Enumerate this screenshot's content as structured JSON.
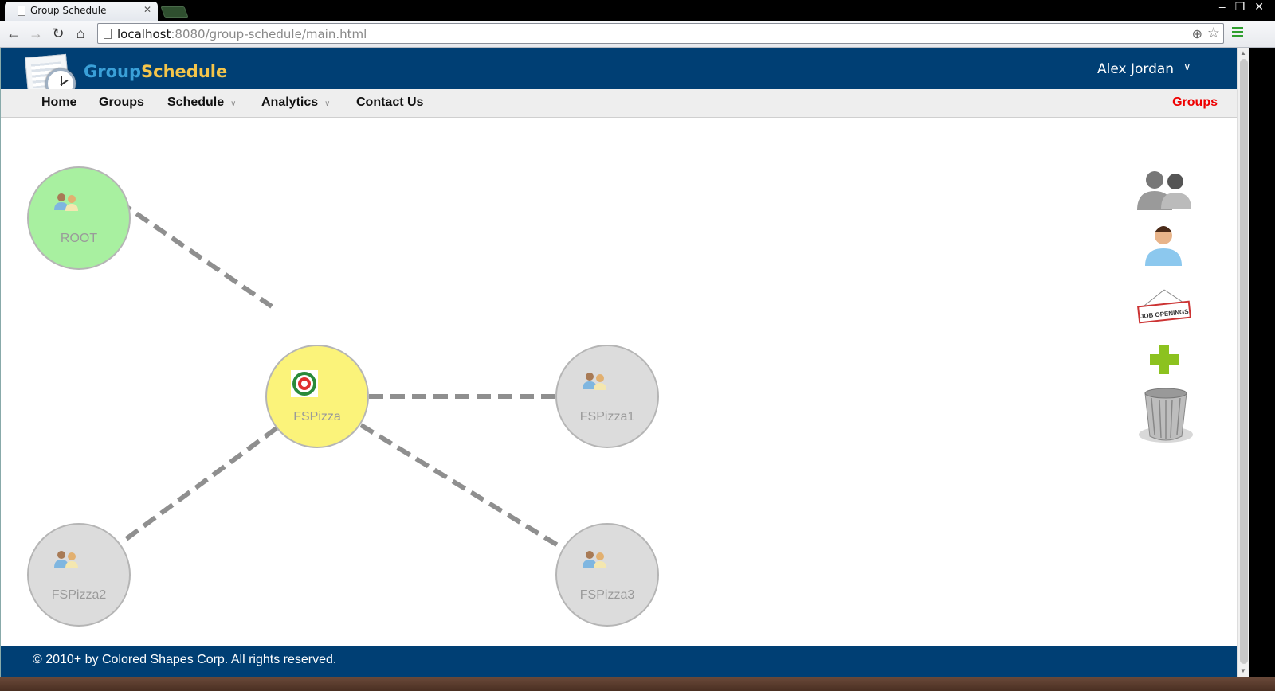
{
  "browser": {
    "tab_title": "Group Schedule",
    "url_host": "localhost",
    "url_path": ":8080/group-schedule/main.html"
  },
  "header": {
    "brand_part1": "Group",
    "brand_part2": "Schedule",
    "user_name": "Alex  Jordan"
  },
  "nav": {
    "items": [
      {
        "label": "Home"
      },
      {
        "label": "Groups"
      },
      {
        "label": "Schedule",
        "has_dropdown": true
      },
      {
        "label": "Analytics",
        "has_dropdown": true
      },
      {
        "label": "Contact Us"
      }
    ],
    "current_section": "Groups"
  },
  "graph": {
    "nodes": [
      {
        "label": "ROOT",
        "icon": "group-icon",
        "color": "#a8f0a0"
      },
      {
        "label": "FSPizza",
        "icon": "pizza-logo-icon",
        "color": "#fbf37a"
      },
      {
        "label": "FSPizza1",
        "icon": "group-icon",
        "color": "#dcdcdc"
      },
      {
        "label": "FSPizza2",
        "icon": "group-icon",
        "color": "#dcdcdc"
      },
      {
        "label": "FSPizza3",
        "icon": "group-icon",
        "color": "#dcdcdc"
      }
    ]
  },
  "toolbox": [
    "users-icon",
    "user-icon",
    "job-openings-icon",
    "add-icon",
    "trash-icon"
  ],
  "toolbox_text": {
    "job_openings": "JOB OPENINGS"
  },
  "footer": {
    "copyright": "© 2010+ by Colored Shapes Corp. All rights reserved."
  },
  "colors": {
    "header_bg": "#003f74",
    "brand_blue": "#3aa0d8",
    "brand_gold": "#f5c54a",
    "active_nav": "#ee0000"
  }
}
